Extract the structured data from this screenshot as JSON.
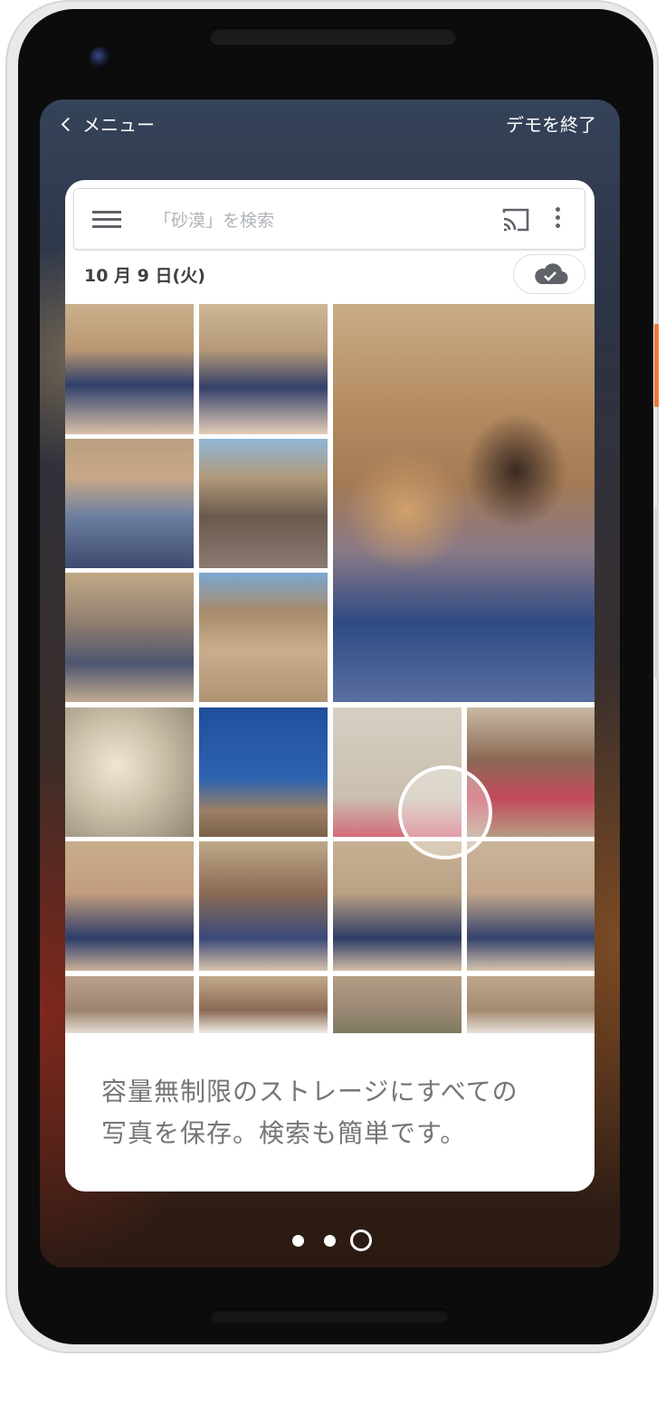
{
  "topbar": {
    "back_label": "メニュー",
    "end_label": "デモを終了"
  },
  "search": {
    "placeholder": "「砂漠」を検索"
  },
  "date_header": "10 月 9 日(火)",
  "caption": {
    "line1": "容量無制限のストレージにすべての",
    "line2": "写真を保存。検索も簡単です。"
  },
  "pagination": {
    "total": 3,
    "active_index": 2
  },
  "icons": [
    "chevron-left-icon",
    "menu-icon",
    "cast-icon",
    "more-vert-icon",
    "cloud-done-icon"
  ],
  "colors": {
    "caption_text": "#757575",
    "toolbar_icon": "#5f6368",
    "screen_bg_top": "#35435a",
    "screen_bg_bottom": "#2a1a12"
  }
}
